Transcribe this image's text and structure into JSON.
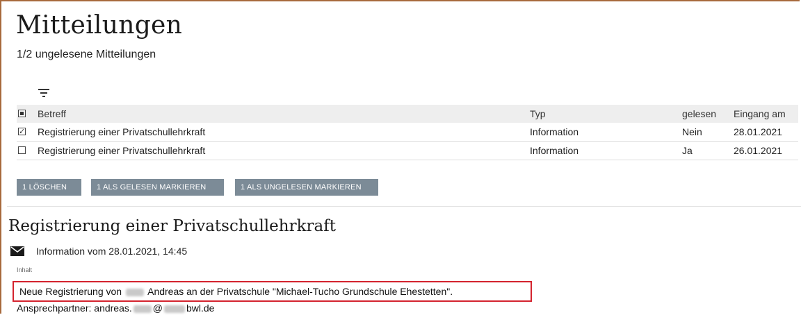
{
  "page": {
    "title": "Mitteilungen",
    "subtitle": "1/2 ungelesene Mitteilungen"
  },
  "toolbar": {
    "filter_icon": "filter-icon"
  },
  "table": {
    "columns": {
      "subject": "Betreff",
      "type": "Typ",
      "read": "gelesen",
      "date": "Eingang am"
    },
    "rows": [
      {
        "checked": true,
        "subject": "Registrierung einer Privatschullehrkraft",
        "type": "Information",
        "read": "Nein",
        "date": "28.01.2021"
      },
      {
        "checked": false,
        "subject": "Registrierung einer Privatschullehrkraft",
        "type": "Information",
        "read": "Ja",
        "date": "26.01.2021"
      }
    ]
  },
  "actions": {
    "delete_label": "1 LÖSCHEN",
    "mark_read_label": "1 ALS GELESEN MARKIEREN",
    "mark_unread_label": "1 ALS UNGELESEN MARKIEREN"
  },
  "message": {
    "title": "Registrierung einer Privatschullehrkraft",
    "icon": "envelope-icon",
    "meta": "Information vom 28.01.2021, 14:45",
    "content_label": "Inhalt",
    "line1_prefix": "Neue Registrierung von",
    "line1_suffix": "Andreas an der Privatschule \"Michael-Tucho Grundschule Ehestetten\".",
    "line2_prefix": "Ansprechpartner: andreas.",
    "line2_mid": "@",
    "line2_suffix": "bwl.de"
  },
  "colors": {
    "button_bg": "#7c8b97",
    "highlight_border": "#d4232e",
    "header_bg": "#eeeeee"
  }
}
